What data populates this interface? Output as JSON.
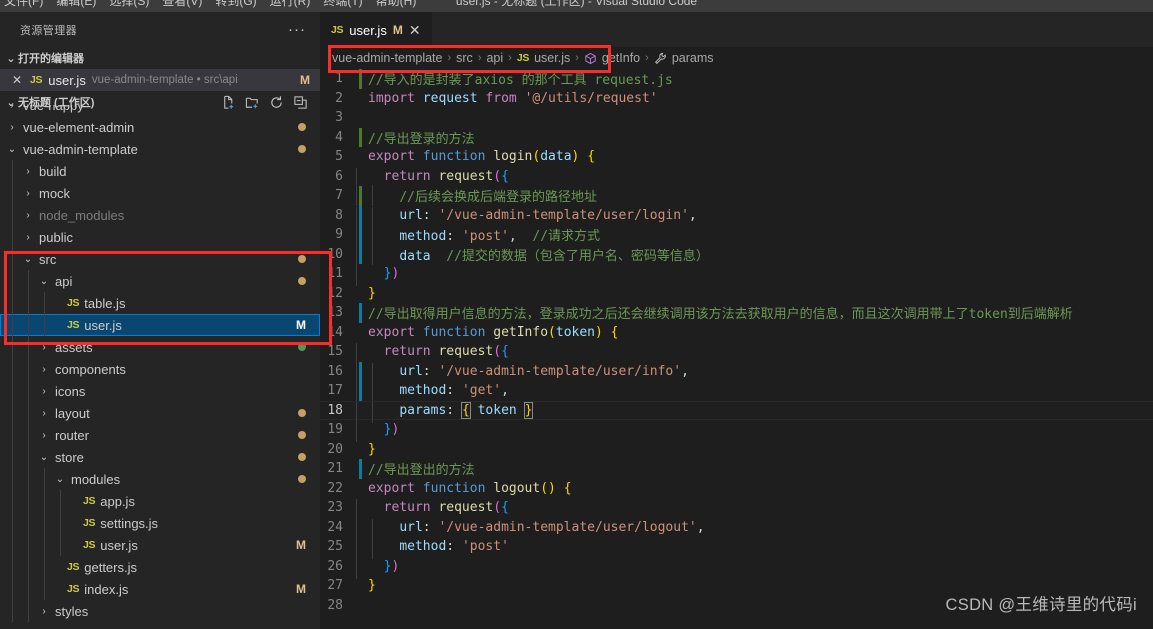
{
  "window": {
    "title": "user.js - 无标题 (工作区) - Visual Studio Code",
    "menus": [
      "文件(F)",
      "编辑(E)",
      "选择(S)",
      "查看(V)",
      "转到(G)",
      "运行(R)",
      "终端(T)",
      "帮助(H)"
    ]
  },
  "sidebar": {
    "title": "资源管理器",
    "more_label": "···",
    "open_editors": {
      "label": "打开的编辑器",
      "twisty": "⌄",
      "items": [
        {
          "close": "✕",
          "icon": "JS",
          "name": "user.js",
          "description": "vue-admin-template • src\\api",
          "badge": "M"
        }
      ]
    },
    "workspace": {
      "label": "无标题 (工作区)",
      "twisty": "⌄",
      "actions": [
        "new-file-icon",
        "new-folder-icon",
        "refresh-icon",
        "collapse-all-icon"
      ]
    },
    "tree": [
      {
        "label": "vue-happy",
        "indent": 0,
        "twisty": "›",
        "kind": "folder",
        "dot": "",
        "badge": "",
        "clipped": true
      },
      {
        "label": "vue-element-admin",
        "indent": 0,
        "twisty": "›",
        "kind": "folder",
        "dot": "#c5a063",
        "badge": ""
      },
      {
        "label": "vue-admin-template",
        "indent": 0,
        "twisty": "⌄",
        "kind": "folder",
        "dot": "#c5a063",
        "badge": ""
      },
      {
        "label": "build",
        "indent": 1,
        "twisty": "›",
        "kind": "folder",
        "dot": "",
        "badge": ""
      },
      {
        "label": "mock",
        "indent": 1,
        "twisty": "›",
        "kind": "folder",
        "dot": "",
        "badge": ""
      },
      {
        "label": "node_modules",
        "indent": 1,
        "twisty": "›",
        "kind": "folder-dim",
        "dot": "",
        "badge": ""
      },
      {
        "label": "public",
        "indent": 1,
        "twisty": "›",
        "kind": "folder",
        "dot": "",
        "badge": ""
      },
      {
        "label": "src",
        "indent": 1,
        "twisty": "⌄",
        "kind": "folder",
        "dot": "#c5a063",
        "badge": ""
      },
      {
        "label": "api",
        "indent": 2,
        "twisty": "⌄",
        "kind": "folder",
        "dot": "#c5a063",
        "badge": ""
      },
      {
        "label": "table.js",
        "indent": 3,
        "twisty": "",
        "kind": "js",
        "dot": "",
        "badge": ""
      },
      {
        "label": "user.js",
        "indent": 3,
        "twisty": "",
        "kind": "js",
        "dot": "",
        "badge": "M",
        "selected": true
      },
      {
        "label": "assets",
        "indent": 2,
        "twisty": "›",
        "kind": "folder",
        "dot": "#4e9a52",
        "badge": ""
      },
      {
        "label": "components",
        "indent": 2,
        "twisty": "›",
        "kind": "folder",
        "dot": "",
        "badge": ""
      },
      {
        "label": "icons",
        "indent": 2,
        "twisty": "›",
        "kind": "folder",
        "dot": "",
        "badge": ""
      },
      {
        "label": "layout",
        "indent": 2,
        "twisty": "›",
        "kind": "folder",
        "dot": "#c5a063",
        "badge": ""
      },
      {
        "label": "router",
        "indent": 2,
        "twisty": "›",
        "kind": "folder",
        "dot": "#c5a063",
        "badge": ""
      },
      {
        "label": "store",
        "indent": 2,
        "twisty": "⌄",
        "kind": "folder",
        "dot": "#c5a063",
        "badge": ""
      },
      {
        "label": "modules",
        "indent": 3,
        "twisty": "⌄",
        "kind": "folder",
        "dot": "#c5a063",
        "badge": ""
      },
      {
        "label": "app.js",
        "indent": 4,
        "twisty": "",
        "kind": "js",
        "dot": "",
        "badge": ""
      },
      {
        "label": "settings.js",
        "indent": 4,
        "twisty": "",
        "kind": "js",
        "dot": "",
        "badge": ""
      },
      {
        "label": "user.js",
        "indent": 4,
        "twisty": "",
        "kind": "js",
        "dot": "",
        "badge": "M"
      },
      {
        "label": "getters.js",
        "indent": 3,
        "twisty": "",
        "kind": "js",
        "dot": "",
        "badge": ""
      },
      {
        "label": "index.js",
        "indent": 3,
        "twisty": "",
        "kind": "js",
        "dot": "",
        "badge": "M"
      },
      {
        "label": "styles",
        "indent": 2,
        "twisty": "›",
        "kind": "folder",
        "dot": "",
        "badge": ""
      }
    ]
  },
  "editor": {
    "tab": {
      "icon": "JS",
      "label": "user.js",
      "modified_badge": "M",
      "close": "✕"
    },
    "breadcrumbs": [
      {
        "text": "vue-admin-template",
        "icon": ""
      },
      {
        "text": "src",
        "icon": ""
      },
      {
        "text": "api",
        "icon": ""
      },
      {
        "text": "user.js",
        "icon": "JS"
      },
      {
        "text": "getInfo",
        "icon": "cube-icon"
      },
      {
        "text": "params",
        "icon": "wrench-icon"
      }
    ],
    "separator": "›",
    "current_line": 18,
    "lines": [
      {
        "n": 1,
        "git": "#4a7a2a",
        "indent": 0,
        "tokens": [
          [
            "c-comment",
            "//导入的是封装了axios 的那个工具 request.js"
          ]
        ]
      },
      {
        "n": 2,
        "git": "",
        "indent": 0,
        "tokens": [
          [
            "c-key",
            "import"
          ],
          [
            "c-plain",
            " "
          ],
          [
            "c-var",
            "request"
          ],
          [
            "c-plain",
            " "
          ],
          [
            "c-key",
            "from"
          ],
          [
            "c-plain",
            " "
          ],
          [
            "c-str",
            "'@/utils/request'"
          ]
        ]
      },
      {
        "n": 3,
        "git": "",
        "indent": 0,
        "tokens": []
      },
      {
        "n": 4,
        "git": "#4a7a2a",
        "indent": 0,
        "tokens": [
          [
            "c-comment",
            "//导出登录的方法"
          ]
        ]
      },
      {
        "n": 5,
        "git": "",
        "indent": 0,
        "tokens": [
          [
            "c-key",
            "export"
          ],
          [
            "c-plain",
            " "
          ],
          [
            "c-key2",
            "function"
          ],
          [
            "c-plain",
            " "
          ],
          [
            "c-fn",
            "login"
          ],
          [
            "c-p1",
            "("
          ],
          [
            "c-var",
            "data"
          ],
          [
            "c-p1",
            ")"
          ],
          [
            "c-plain",
            " "
          ],
          [
            "c-p1",
            "{"
          ]
        ]
      },
      {
        "n": 6,
        "git": "",
        "indent": 1,
        "tokens": [
          [
            "c-plain",
            "  "
          ],
          [
            "c-key",
            "return"
          ],
          [
            "c-plain",
            " "
          ],
          [
            "c-fn",
            "request"
          ],
          [
            "c-p2",
            "("
          ],
          [
            "c-p3",
            "{"
          ]
        ]
      },
      {
        "n": 7,
        "git": "#4a7a2a",
        "indent": 2,
        "tokens": [
          [
            "c-plain",
            "    "
          ],
          [
            "c-comment",
            "//后续会换成后端登录的路径地址"
          ]
        ]
      },
      {
        "n": 8,
        "git": "#0c7d9d",
        "indent": 2,
        "tokens": [
          [
            "c-plain",
            "    "
          ],
          [
            "c-prop",
            "url"
          ],
          [
            "c-plain",
            ": "
          ],
          [
            "c-str",
            "'/vue-admin-template/user/login'"
          ],
          [
            "c-plain",
            ","
          ]
        ]
      },
      {
        "n": 9,
        "git": "#0c7d9d",
        "indent": 2,
        "tokens": [
          [
            "c-plain",
            "    "
          ],
          [
            "c-prop",
            "method"
          ],
          [
            "c-plain",
            ": "
          ],
          [
            "c-str",
            "'post'"
          ],
          [
            "c-plain",
            ",  "
          ],
          [
            "c-comment",
            "//请求方式"
          ]
        ]
      },
      {
        "n": 10,
        "git": "#0c7d9d",
        "indent": 2,
        "tokens": [
          [
            "c-plain",
            "    "
          ],
          [
            "c-prop",
            "data"
          ],
          [
            "c-plain",
            "  "
          ],
          [
            "c-comment",
            "//提交的数据（包含了用户名、密码等信息）"
          ]
        ]
      },
      {
        "n": 11,
        "git": "",
        "indent": 1,
        "tokens": [
          [
            "c-plain",
            "  "
          ],
          [
            "c-p3",
            "}"
          ],
          [
            "c-p2",
            ")"
          ]
        ]
      },
      {
        "n": 12,
        "git": "",
        "indent": 0,
        "tokens": [
          [
            "c-p1",
            "}"
          ]
        ]
      },
      {
        "n": 13,
        "git": "#0c7d9d",
        "indent": 0,
        "tokens": [
          [
            "c-comment",
            "//导出取得用户信息的方法，登录成功之后还会继续调用该方法去获取用户的信息，而且这次调用带上了token到后端解析"
          ]
        ]
      },
      {
        "n": 14,
        "git": "",
        "indent": 0,
        "tokens": [
          [
            "c-key",
            "export"
          ],
          [
            "c-plain",
            " "
          ],
          [
            "c-key2",
            "function"
          ],
          [
            "c-plain",
            " "
          ],
          [
            "c-fn",
            "getInfo"
          ],
          [
            "c-p1",
            "("
          ],
          [
            "c-var",
            "token"
          ],
          [
            "c-p1",
            ")"
          ],
          [
            "c-plain",
            " "
          ],
          [
            "c-p1",
            "{"
          ]
        ]
      },
      {
        "n": 15,
        "git": "",
        "indent": 1,
        "tokens": [
          [
            "c-plain",
            "  "
          ],
          [
            "c-key",
            "return"
          ],
          [
            "c-plain",
            " "
          ],
          [
            "c-fn",
            "request"
          ],
          [
            "c-p2",
            "("
          ],
          [
            "c-p3",
            "{"
          ]
        ]
      },
      {
        "n": 16,
        "git": "#0c7d9d",
        "indent": 2,
        "tokens": [
          [
            "c-plain",
            "    "
          ],
          [
            "c-prop",
            "url"
          ],
          [
            "c-plain",
            ": "
          ],
          [
            "c-str",
            "'/vue-admin-template/user/info'"
          ],
          [
            "c-plain",
            ","
          ]
        ]
      },
      {
        "n": 17,
        "git": "#0c7d9d",
        "indent": 2,
        "tokens": [
          [
            "c-plain",
            "    "
          ],
          [
            "c-prop",
            "method"
          ],
          [
            "c-plain",
            ": "
          ],
          [
            "c-str",
            "'get'"
          ],
          [
            "c-plain",
            ","
          ]
        ]
      },
      {
        "n": 18,
        "git": "",
        "indent": 2,
        "active": true,
        "tokens": [
          [
            "c-plain",
            "    "
          ],
          [
            "c-prop",
            "params"
          ],
          [
            "c-plain",
            ": "
          ],
          [
            "c-p1 bracketmatch",
            "{"
          ],
          [
            "c-plain",
            " "
          ],
          [
            "c-var",
            "token"
          ],
          [
            "c-plain",
            " "
          ],
          [
            "c-p1 bracketmatch",
            "}"
          ]
        ]
      },
      {
        "n": 19,
        "git": "",
        "indent": 1,
        "tokens": [
          [
            "c-plain",
            "  "
          ],
          [
            "c-p3",
            "}"
          ],
          [
            "c-p2",
            ")"
          ]
        ]
      },
      {
        "n": 20,
        "git": "",
        "indent": 0,
        "tokens": [
          [
            "c-p1",
            "}"
          ]
        ]
      },
      {
        "n": 21,
        "git": "#0c7d9d",
        "indent": 0,
        "tokens": [
          [
            "c-comment",
            "//导出登出的方法"
          ]
        ]
      },
      {
        "n": 22,
        "git": "",
        "indent": 0,
        "tokens": [
          [
            "c-key",
            "export"
          ],
          [
            "c-plain",
            " "
          ],
          [
            "c-key2",
            "function"
          ],
          [
            "c-plain",
            " "
          ],
          [
            "c-fn",
            "logout"
          ],
          [
            "c-p1",
            "()"
          ],
          [
            "c-plain",
            " "
          ],
          [
            "c-p1",
            "{"
          ]
        ]
      },
      {
        "n": 23,
        "git": "",
        "indent": 1,
        "tokens": [
          [
            "c-plain",
            "  "
          ],
          [
            "c-key",
            "return"
          ],
          [
            "c-plain",
            " "
          ],
          [
            "c-fn",
            "request"
          ],
          [
            "c-p2",
            "("
          ],
          [
            "c-p3",
            "{"
          ]
        ]
      },
      {
        "n": 24,
        "git": "",
        "indent": 2,
        "tokens": [
          [
            "c-plain",
            "    "
          ],
          [
            "c-prop",
            "url"
          ],
          [
            "c-plain",
            ": "
          ],
          [
            "c-str",
            "'/vue-admin-template/user/logout'"
          ],
          [
            "c-plain",
            ","
          ]
        ]
      },
      {
        "n": 25,
        "git": "",
        "indent": 2,
        "tokens": [
          [
            "c-plain",
            "    "
          ],
          [
            "c-prop",
            "method"
          ],
          [
            "c-plain",
            ": "
          ],
          [
            "c-str",
            "'post'"
          ]
        ]
      },
      {
        "n": 26,
        "git": "",
        "indent": 1,
        "tokens": [
          [
            "c-plain",
            "  "
          ],
          [
            "c-p3",
            "}"
          ],
          [
            "c-p2",
            ")"
          ]
        ]
      },
      {
        "n": 27,
        "git": "",
        "indent": 0,
        "tokens": [
          [
            "c-p1",
            "}"
          ]
        ]
      },
      {
        "n": 28,
        "git": "",
        "indent": 0,
        "tokens": []
      }
    ]
  },
  "watermark": "CSDN @王维诗里的代码i",
  "colors": {
    "accent_selected": "#094771",
    "annotation_red": "#fb2c2c",
    "modified_badge": "#e2c08d",
    "editor_bg": "#1e1e1e",
    "sidebar_bg": "#252526"
  }
}
